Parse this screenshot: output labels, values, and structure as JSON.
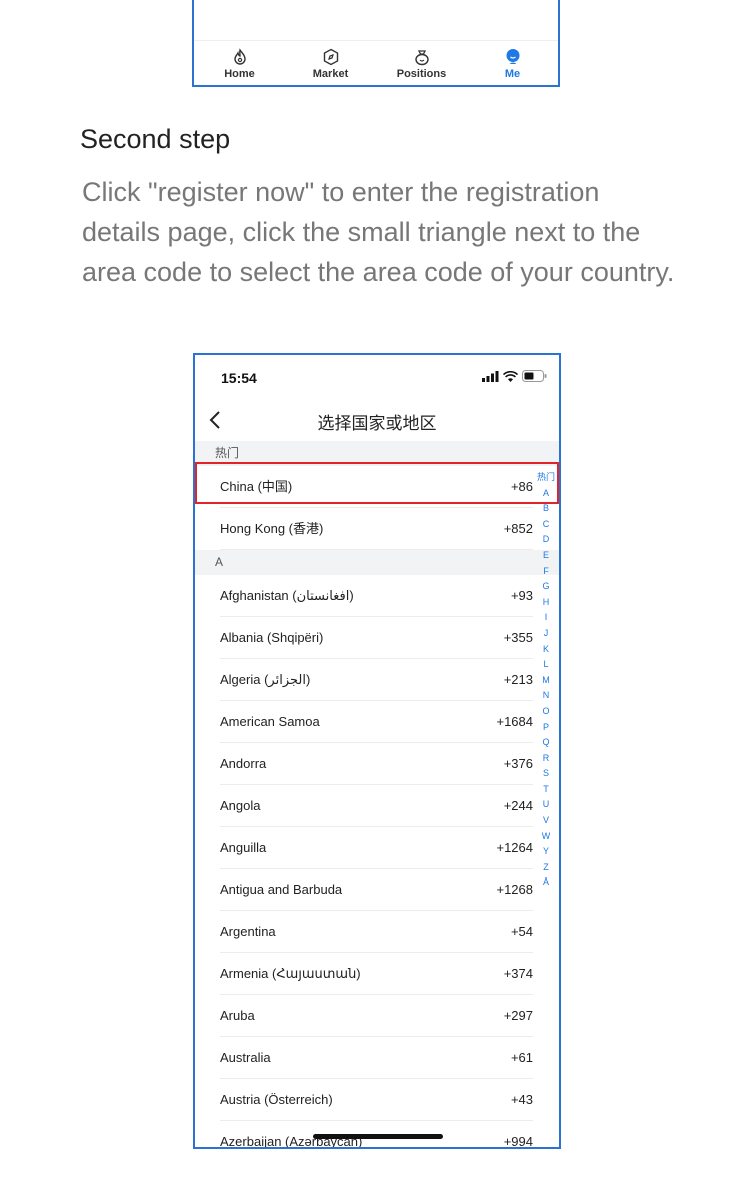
{
  "top_tabbar": {
    "tabs": [
      {
        "label": "Home",
        "icon": "flame-icon",
        "active": false
      },
      {
        "label": "Market",
        "icon": "compass-icon",
        "active": false
      },
      {
        "label": "Positions",
        "icon": "money-bag-icon",
        "active": false
      },
      {
        "label": "Me",
        "icon": "person-icon",
        "active": true
      }
    ]
  },
  "step": {
    "title": "Second step",
    "description": "Click \"register now\" to enter the registration details page, click the small triangle next to the area code to select the area code of your country."
  },
  "phone": {
    "status_time": "15:54",
    "nav_title": "选择国家或地区",
    "hot_header": "热门",
    "hot_rows": [
      {
        "name": "China (中国)",
        "code": "+86"
      },
      {
        "name": "Hong Kong (香港)",
        "code": "+852"
      }
    ],
    "a_header": "A",
    "a_rows": [
      {
        "name": "Afghanistan (افغانستان)",
        "code": "+93"
      },
      {
        "name": "Albania (Shqipëri)",
        "code": "+355"
      },
      {
        "name": "Algeria (الجزائر)",
        "code": "+213"
      },
      {
        "name": "American Samoa",
        "code": "+1684"
      },
      {
        "name": "Andorra",
        "code": "+376"
      },
      {
        "name": "Angola",
        "code": "+244"
      },
      {
        "name": "Anguilla",
        "code": "+1264"
      },
      {
        "name": "Antigua and Barbuda",
        "code": "+1268"
      },
      {
        "name": "Argentina",
        "code": "+54"
      },
      {
        "name": "Armenia (Հայաստան)",
        "code": "+374"
      },
      {
        "name": "Aruba",
        "code": "+297"
      },
      {
        "name": "Australia",
        "code": "+61"
      },
      {
        "name": "Austria (Österreich)",
        "code": "+43"
      },
      {
        "name": "Azerbaijan (Azərbaycan)",
        "code": "+994"
      }
    ],
    "index_letters": [
      "热门",
      "A",
      "B",
      "C",
      "D",
      "E",
      "F",
      "G",
      "H",
      "I",
      "J",
      "K",
      "L",
      "M",
      "N",
      "O",
      "P",
      "Q",
      "R",
      "S",
      "T",
      "U",
      "V",
      "W",
      "Y",
      "Z",
      "Å"
    ],
    "accent_color": "#1e78e6",
    "highlight_color": "#e0242a"
  }
}
